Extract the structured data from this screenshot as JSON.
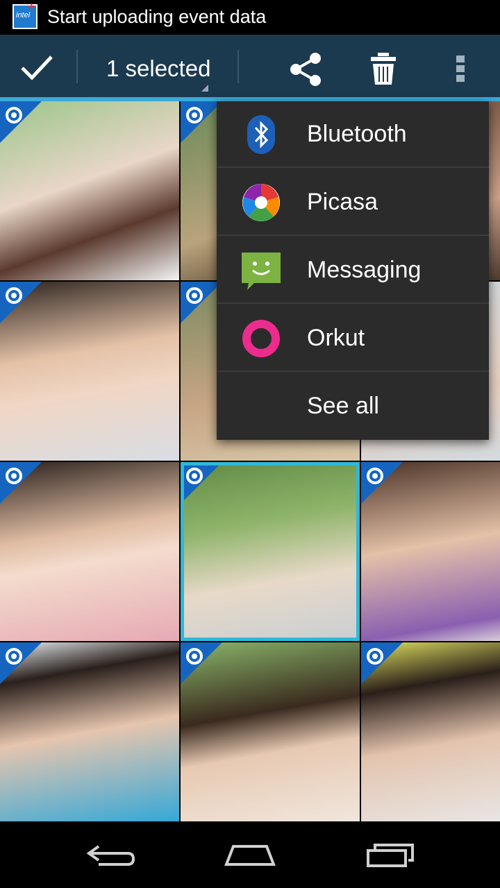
{
  "status_bar": {
    "notification_text": "Start uploading event data",
    "icon": "intel-upload-icon",
    "icon_logo_text": "intel"
  },
  "action_bar": {
    "title": "1 selected",
    "done_icon": "check-icon",
    "share_icon": "share-icon",
    "delete_icon": "trash-icon",
    "overflow_icon": "overflow-menu-icon",
    "color": "#1b3a4f",
    "accent": "#3aa9d9"
  },
  "share_menu": {
    "items": [
      {
        "label": "Bluetooth",
        "icon": "bluetooth-icon"
      },
      {
        "label": "Picasa",
        "icon": "picasa-icon"
      },
      {
        "label": "Messaging",
        "icon": "messaging-icon"
      },
      {
        "label": "Orkut",
        "icon": "orkut-icon"
      },
      {
        "label": "See all",
        "icon": ""
      }
    ]
  },
  "photo_grid": {
    "badge_icon": "picasa-album-icon",
    "selected_index": 7,
    "photos": [
      {
        "row": 1,
        "col": 1,
        "description": "photo"
      },
      {
        "row": 1,
        "col": 2,
        "description": "photo"
      },
      {
        "row": 1,
        "col": 3,
        "description": "photo"
      },
      {
        "row": 2,
        "col": 1,
        "description": "photo"
      },
      {
        "row": 2,
        "col": 2,
        "description": "photo"
      },
      {
        "row": 2,
        "col": 3,
        "description": "photo"
      },
      {
        "row": 3,
        "col": 1,
        "description": "photo"
      },
      {
        "row": 3,
        "col": 2,
        "description": "photo"
      },
      {
        "row": 3,
        "col": 3,
        "description": "photo"
      },
      {
        "row": 4,
        "col": 1,
        "description": "photo"
      },
      {
        "row": 4,
        "col": 2,
        "description": "photo"
      },
      {
        "row": 4,
        "col": 3,
        "description": "photo"
      }
    ]
  },
  "nav_bar": {
    "back_icon": "back-icon",
    "home_icon": "home-icon",
    "recents_icon": "recent-apps-icon"
  }
}
